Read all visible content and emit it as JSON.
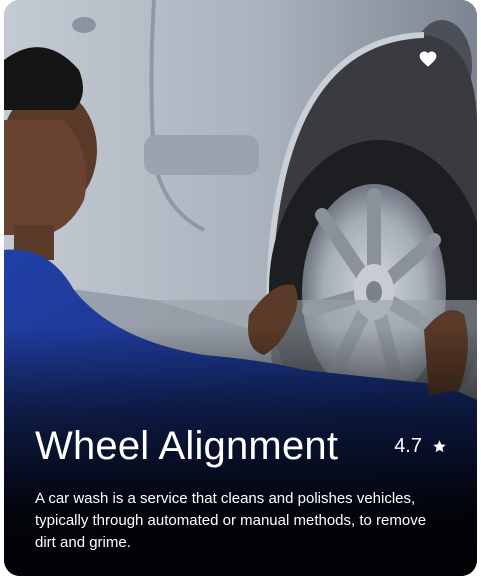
{
  "card": {
    "title": "Wheel Alignment",
    "rating": "4.7",
    "description": "A car wash is a service that cleans and polishes vehicles, typically through automated or manual methods, to remove dirt and grime.",
    "favorite_icon": "heart-icon",
    "rating_icon": "star-icon",
    "image_subject": "mechanic adjusting car wheel",
    "colors": {
      "text": "#ffffff",
      "overlay": "#000000",
      "uniform": "#1f3c9a",
      "car_body": "#b7bec8"
    }
  }
}
